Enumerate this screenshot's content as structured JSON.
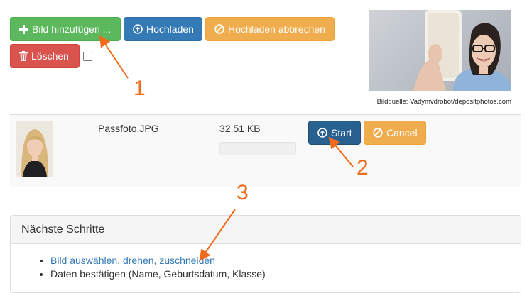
{
  "toolbar": {
    "add_label": "Bild hinzufügen ...",
    "upload_label": "Hochladen",
    "cancel_upload_label": "Hochladen abbrechen",
    "delete_label": "Löschen"
  },
  "preview": {
    "credit": "Bildquelle: Vadymvdrobot/depositphotos.com"
  },
  "file": {
    "name": "Passfoto.JPG",
    "size": "32.51 KB",
    "progress": 0,
    "start_label": "Start",
    "cancel_label": "Cancel"
  },
  "next_steps": {
    "title": "Nächste Schritte",
    "items": [
      "Bild auswählen, drehen, zuschneiden",
      "Daten bestätigen (Name, Geburtsdatum, Klasse)"
    ]
  },
  "annotations": {
    "marker_1": "1",
    "marker_2": "2",
    "marker_3": "3",
    "color": "#f26a1b"
  },
  "icons": {
    "add": "plus-icon",
    "upload": "upload-circle-icon",
    "cancel": "ban-icon",
    "delete": "trash-icon"
  }
}
